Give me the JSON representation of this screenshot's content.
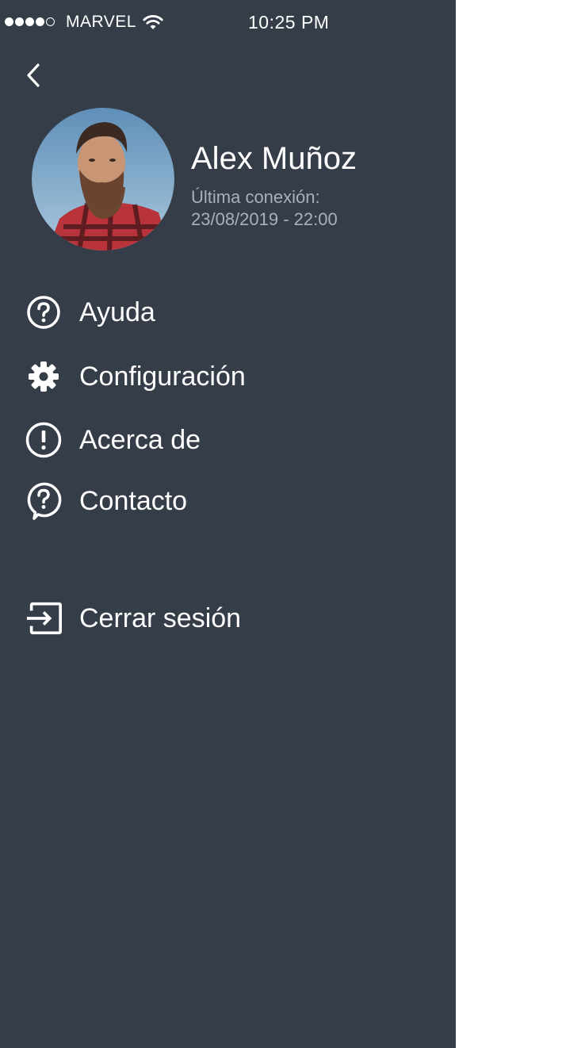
{
  "status_bar": {
    "carrier": "MARVEL",
    "time": "10:25 PM"
  },
  "profile": {
    "name": "Alex Muñoz",
    "last_connection_label": "Última conexión:",
    "last_connection_value": "23/08/2019 - 22:00"
  },
  "menu": {
    "items": [
      {
        "label": "Ayuda",
        "icon": "help-circle-icon"
      },
      {
        "label": "Configuración",
        "icon": "gear-icon"
      },
      {
        "label": "Acerca de",
        "icon": "exclamation-circle-icon"
      },
      {
        "label": "Contacto",
        "icon": "question-bubble-icon"
      }
    ],
    "logout_label": "Cerrar sesión"
  },
  "colors": {
    "drawer_background": "#353d49",
    "secondary_text": "#a7b0be",
    "page_background": "#ffffff"
  }
}
